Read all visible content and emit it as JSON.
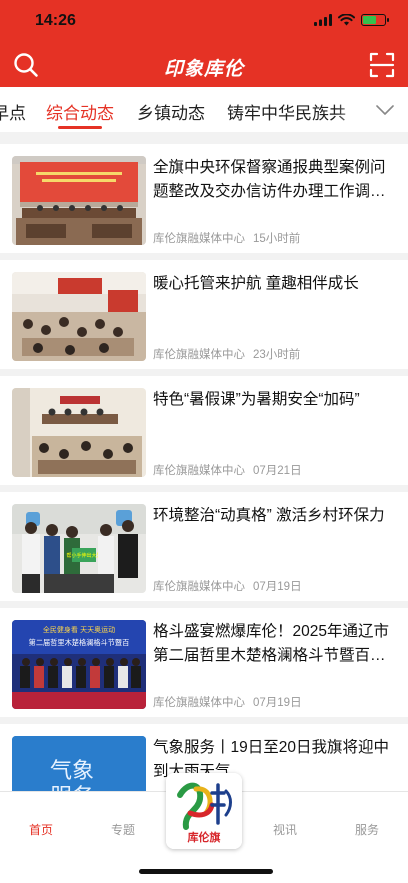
{
  "status": {
    "time": "14:26"
  },
  "header": {
    "app_title": "印象库伦"
  },
  "tabs": [
    "早点",
    "综合动态",
    "乡镇动态",
    "铸牢中华民族共"
  ],
  "active_tab": 1,
  "feed": [
    {
      "title": "全旗中央环保督察通报典型案例问题整改及交办信访件办理工作调度会",
      "source": "库伦旗融媒体中心",
      "time": "15小时前"
    },
    {
      "title": "暖心托管来护航 童趣相伴成长",
      "source": "库伦旗融媒体中心",
      "time": "23小时前"
    },
    {
      "title": "特色“暑假课”为暑期安全“加码”",
      "source": "库伦旗融媒体中心",
      "time": "07月21日"
    },
    {
      "title": "环境整治“动真格” 激活乡村环保力",
      "source": "库伦旗融媒体中心",
      "time": "07月19日"
    },
    {
      "title": "格斗盛宴燃爆库伦！2025年通辽市第二届哲里木楚格澜格斗节暨百万网友",
      "source": "库伦旗融媒体中心",
      "time": "07月19日"
    },
    {
      "title": "气象服务丨19日至20日我旗将迎中到大雨天气",
      "source": "",
      "time": ""
    }
  ],
  "thumb_text": {
    "banner_top": "全民健身看 天天奥运动",
    "banner_main": "第二届哲里木楚格澜格斗节暨百",
    "sign_1": "帮小手伸出大爱",
    "weather_1": "气象",
    "weather_2": "服务"
  },
  "bottom_nav": {
    "home": "首页",
    "topics": "专题",
    "video": "视讯",
    "services": "服务",
    "center_label": "库伦旗"
  },
  "colors": {
    "brand_red": "#e53225",
    "battery_green": "#33c24d"
  }
}
